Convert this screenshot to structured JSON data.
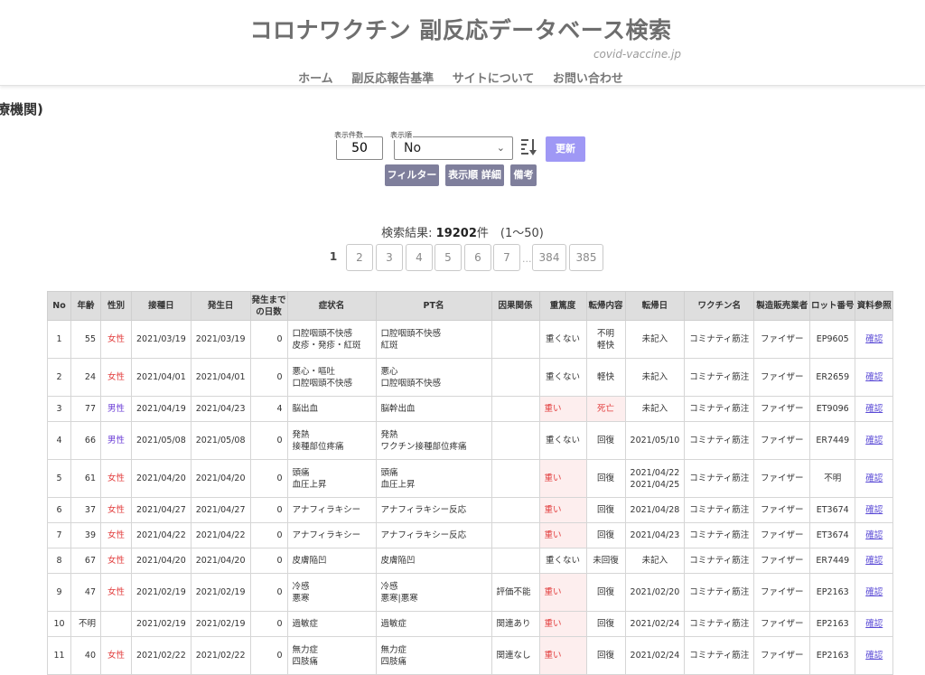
{
  "header": {
    "title": "コロナワクチン 副反応データベース検索",
    "domain": "covid-vaccine.jp",
    "nav": [
      "ホーム",
      "副反応報告基準",
      "サイトについて",
      "お問い合わせ"
    ]
  },
  "page_heading": "療機関)",
  "controls": {
    "count_label": "表示件数",
    "count_value": "50",
    "order_label": "表示順",
    "order_value": "No",
    "update_label": "更新",
    "filter_label": "フィルター",
    "order_detail_label": "表示順 詳細",
    "notes_label": "備考"
  },
  "result": {
    "prefix": "検索結果:",
    "count": "19202",
    "suffix": "件　(1〜50)"
  },
  "pager": {
    "current": "1",
    "pages": [
      "2",
      "3",
      "4",
      "5",
      "6",
      "7"
    ],
    "dots": "...",
    "last_pages": [
      "384",
      "385"
    ]
  },
  "table": {
    "headers": [
      "No",
      "年齢",
      "性別",
      "接種日",
      "発生日",
      "発生まで\nの日数",
      "症状名",
      "PT名",
      "因果関係",
      "重篤度",
      "転帰内容",
      "転帰日",
      "ワクチン名",
      "製造販売業者",
      "ロット番号",
      "資料参照"
    ],
    "rows": [
      {
        "no": "1",
        "age": "55",
        "sex": "女性",
        "sex_type": "f",
        "vacc": "2021/03/19",
        "onset": "2021/03/19",
        "days": "0",
        "symptom": [
          "口腔咽頭不快感",
          "皮疹・発疹・紅斑"
        ],
        "pt": [
          "口腔咽頭不快感",
          "紅斑"
        ],
        "causal": "",
        "severity": "重くない",
        "sev_flag": false,
        "outcome": [
          "不明",
          "軽快"
        ],
        "out_flag": false,
        "outdate": [
          "未記入"
        ],
        "vaccine": "コミナティ筋注",
        "maker": "ファイザー",
        "lot": "EP9605",
        "ref": "確認"
      },
      {
        "no": "2",
        "age": "24",
        "sex": "女性",
        "sex_type": "f",
        "vacc": "2021/04/01",
        "onset": "2021/04/01",
        "days": "0",
        "symptom": [
          "悪心・嘔吐",
          "口腔咽頭不快感"
        ],
        "pt": [
          "悪心",
          "口腔咽頭不快感"
        ],
        "causal": "",
        "severity": "重くない",
        "sev_flag": false,
        "outcome": [
          "軽快"
        ],
        "out_flag": false,
        "outdate": [
          "未記入"
        ],
        "vaccine": "コミナティ筋注",
        "maker": "ファイザー",
        "lot": "ER2659",
        "ref": "確認"
      },
      {
        "no": "3",
        "age": "77",
        "sex": "男性",
        "sex_type": "m",
        "vacc": "2021/04/19",
        "onset": "2021/04/23",
        "days": "4",
        "symptom": [
          "脳出血"
        ],
        "pt": [
          "脳幹出血"
        ],
        "causal": "",
        "severity": "重い",
        "sev_flag": true,
        "outcome": [
          "死亡"
        ],
        "out_flag": true,
        "outdate": [
          "未記入"
        ],
        "vaccine": "コミナティ筋注",
        "maker": "ファイザー",
        "lot": "ET9096",
        "ref": "確認"
      },
      {
        "no": "4",
        "age": "66",
        "sex": "男性",
        "sex_type": "m",
        "vacc": "2021/05/08",
        "onset": "2021/05/08",
        "days": "0",
        "symptom": [
          "発熱",
          "接種部位疼痛"
        ],
        "pt": [
          "発熱",
          "ワクチン接種部位疼痛"
        ],
        "causal": "",
        "severity": "重くない",
        "sev_flag": false,
        "outcome": [
          "回復"
        ],
        "out_flag": false,
        "outdate": [
          "2021/05/10"
        ],
        "vaccine": "コミナティ筋注",
        "maker": "ファイザー",
        "lot": "ER7449",
        "ref": "確認"
      },
      {
        "no": "5",
        "age": "61",
        "sex": "女性",
        "sex_type": "f",
        "vacc": "2021/04/20",
        "onset": "2021/04/20",
        "days": "0",
        "symptom": [
          "頭痛",
          "血圧上昇"
        ],
        "pt": [
          "頭痛",
          "血圧上昇"
        ],
        "causal": "",
        "severity": "重い",
        "sev_flag": true,
        "outcome": [
          "回復"
        ],
        "out_flag": false,
        "outdate": [
          "2021/04/22",
          "2021/04/25"
        ],
        "vaccine": "コミナティ筋注",
        "maker": "ファイザー",
        "lot": "不明",
        "ref": "確認"
      },
      {
        "no": "6",
        "age": "37",
        "sex": "女性",
        "sex_type": "f",
        "vacc": "2021/04/27",
        "onset": "2021/04/27",
        "days": "0",
        "symptom": [
          "アナフィラキシー"
        ],
        "pt": [
          "アナフィラキシー反応"
        ],
        "causal": "",
        "severity": "重い",
        "sev_flag": true,
        "outcome": [
          "回復"
        ],
        "out_flag": false,
        "outdate": [
          "2021/04/28"
        ],
        "vaccine": "コミナティ筋注",
        "maker": "ファイザー",
        "lot": "ET3674",
        "ref": "確認"
      },
      {
        "no": "7",
        "age": "39",
        "sex": "女性",
        "sex_type": "f",
        "vacc": "2021/04/22",
        "onset": "2021/04/22",
        "days": "0",
        "symptom": [
          "アナフィラキシー"
        ],
        "pt": [
          "アナフィラキシー反応"
        ],
        "causal": "",
        "severity": "重い",
        "sev_flag": true,
        "outcome": [
          "回復"
        ],
        "out_flag": false,
        "outdate": [
          "2021/04/23"
        ],
        "vaccine": "コミナティ筋注",
        "maker": "ファイザー",
        "lot": "ET3674",
        "ref": "確認"
      },
      {
        "no": "8",
        "age": "67",
        "sex": "女性",
        "sex_type": "f",
        "vacc": "2021/04/20",
        "onset": "2021/04/20",
        "days": "0",
        "symptom": [
          "皮膚陥凹"
        ],
        "pt": [
          "皮膚陥凹"
        ],
        "causal": "",
        "severity": "重くない",
        "sev_flag": false,
        "outcome": [
          "未回復"
        ],
        "out_flag": false,
        "outdate": [
          "未記入"
        ],
        "vaccine": "コミナティ筋注",
        "maker": "ファイザー",
        "lot": "ER7449",
        "ref": "確認"
      },
      {
        "no": "9",
        "age": "47",
        "sex": "女性",
        "sex_type": "f",
        "vacc": "2021/02/19",
        "onset": "2021/02/19",
        "days": "0",
        "symptom": [
          "冷感",
          "悪寒"
        ],
        "pt": [
          "冷感",
          "悪寒|悪寒"
        ],
        "causal": "評価不能",
        "severity": "重い",
        "sev_flag": true,
        "outcome": [
          "回復"
        ],
        "out_flag": false,
        "outdate": [
          "2021/02/20"
        ],
        "vaccine": "コミナティ筋注",
        "maker": "ファイザー",
        "lot": "EP2163",
        "ref": "確認"
      },
      {
        "no": "10",
        "age": "不明",
        "sex": "",
        "sex_type": "",
        "vacc": "2021/02/19",
        "onset": "2021/02/19",
        "days": "0",
        "symptom": [
          "過敏症"
        ],
        "pt": [
          "過敏症"
        ],
        "causal": "関連あり",
        "severity": "重い",
        "sev_flag": true,
        "outcome": [
          "回復"
        ],
        "out_flag": false,
        "outdate": [
          "2021/02/24"
        ],
        "vaccine": "コミナティ筋注",
        "maker": "ファイザー",
        "lot": "EP2163",
        "ref": "確認"
      },
      {
        "no": "11",
        "age": "40",
        "sex": "女性",
        "sex_type": "f",
        "vacc": "2021/02/22",
        "onset": "2021/02/22",
        "days": "0",
        "symptom": [
          "無力症",
          "四肢痛"
        ],
        "pt": [
          "無力症",
          "四肢痛"
        ],
        "causal": "関連なし",
        "severity": "重い",
        "sev_flag": true,
        "outcome": [
          "回復"
        ],
        "out_flag": false,
        "outdate": [
          "2021/02/24"
        ],
        "vaccine": "コミナティ筋注",
        "maker": "ファイザー",
        "lot": "EP2163",
        "ref": "確認"
      }
    ]
  }
}
